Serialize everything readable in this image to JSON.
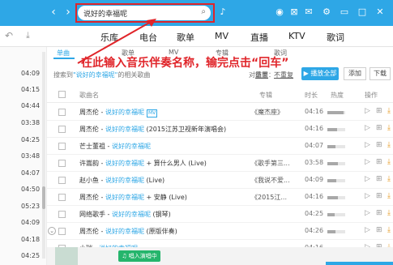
{
  "header": {
    "search_value": "说好的幸福呢",
    "colors": {
      "accent": "#2ea7e6",
      "annotation": "#e0252a",
      "karaoke": "#25b56c"
    }
  },
  "nav": {
    "tabs": [
      "乐库",
      "电台",
      "歌单",
      "MV",
      "直播",
      "KTV",
      "歌词"
    ]
  },
  "subtabs": [
    "单曲",
    "歌单",
    "MV",
    "专辑",
    "歌词"
  ],
  "annotation": "在此输入音乐伴奏名称，输完点击“回车”",
  "sidebar": {
    "times": [
      "04:09",
      "04:15",
      "04:44",
      "03:38",
      "04:25",
      "03:48",
      "04:07",
      "04:50",
      "05:23",
      "04:09",
      "04:18",
      "04:25",
      "04:25"
    ]
  },
  "results": {
    "prefix": "搜索到",
    "keyword": "\"说好的幸福呢\"",
    "suffix": "的相关歌曲",
    "sort_label": "对结果：",
    "sort_options": [
      "重置",
      "不重复"
    ],
    "play_all": "播放全部",
    "add": "添加",
    "download": "下载"
  },
  "table": {
    "headers": {
      "song": "歌曲名",
      "album": "专辑",
      "duration": "时长",
      "heat": "热度",
      "ops": "操作"
    },
    "rows": [
      {
        "artist": "周杰伦 - ",
        "title": "说好的幸福呢",
        "suffix": "",
        "mv": "MV",
        "album": "《魔杰座》",
        "duration": "04:16",
        "heat": 0.9
      },
      {
        "artist": "周杰伦 - ",
        "title": "说好的幸福呢",
        "suffix": " (2015江苏卫视新年演唱会)",
        "mv": "",
        "album": "",
        "duration": "04:16",
        "heat": 0.55
      },
      {
        "artist": "芒士董祖 - ",
        "title": "说好的幸福呢",
        "suffix": "",
        "mv": "",
        "album": "",
        "duration": "04:07",
        "heat": 0.45
      },
      {
        "artist": "许嵩韵 - ",
        "title": "说好的幸福呢",
        "suffix": " + 算什么男人 (Live)",
        "mv": "",
        "album": "《歌手第三...",
        "duration": "03:58",
        "heat": 0.6
      },
      {
        "artist": "赵小鱼 - ",
        "title": "说好的幸福呢",
        "suffix": " (Live)",
        "mv": "",
        "album": "《我说不爱...",
        "duration": "04:09",
        "heat": 0.5
      },
      {
        "artist": "周杰伦 - ",
        "title": "说好的幸福呢",
        "suffix": " + 安静 (Live)",
        "mv": "",
        "album": "《2015江...",
        "duration": "04:16",
        "heat": 0.6
      },
      {
        "artist": "网络歌手 - ",
        "title": "说好的幸福呢",
        "suffix": " (钢琴)",
        "mv": "",
        "album": "",
        "duration": "04:25",
        "heat": 0.4
      },
      {
        "artist": "周杰伦 - ",
        "title": "说好的幸福呢",
        "suffix": " (原版伴奏)",
        "mv": "",
        "album": "",
        "duration": "04:26",
        "heat": 0.45
      },
      {
        "artist": "小瑞 - ",
        "title": "说好的幸福呢",
        "suffix": "",
        "mv": "",
        "album": "",
        "duration": "04:16",
        "heat": 0.4
      }
    ]
  },
  "bottom": {
    "karaoke": "唱入演唱中"
  }
}
